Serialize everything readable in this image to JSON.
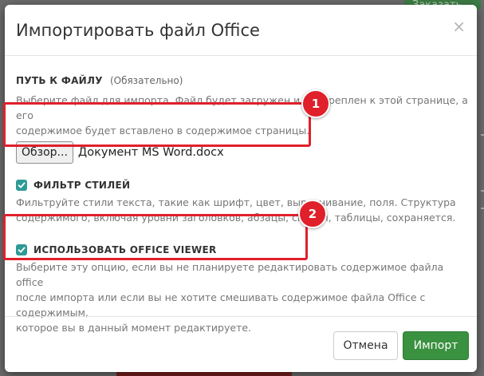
{
  "background": {
    "order_button_label": "Заказать"
  },
  "dialog": {
    "title": "Импортировать файл Office",
    "close_symbol": "×",
    "file_field": {
      "label": "ПУТЬ К ФАЙЛУ",
      "required_note": "(Обязательно)",
      "help_line1": "Выберите файл для импорта. Файл будет загружен и прикреплен к этой странице, а его",
      "help_line2": "содержимое будет вставлено в содержимое страницы.",
      "browse_label": "Обзор...",
      "file_name": "Документ MS Word.docx"
    },
    "style_filter": {
      "label": "ФИЛЬТР СТИЛЕЙ",
      "checked": true,
      "help_line1": "Фильтруйте стили текста, такие как шрифт, цвет, выравнивание, поля. Структура",
      "help_line2": "содержимого, включая уровни заголовков, абзацы, списки, таблицы, сохраняется."
    },
    "office_viewer": {
      "label": "ИСПОЛЬЗОВАТЬ OFFICE VIEWER",
      "checked": true,
      "help_line1": "Выберите эту опцию, если вы не планируете редактировать содержимое файла office",
      "help_line2": "после импорта или если вы не хотите смешивать содержимое файла Office с содержимым,",
      "help_line3": "которое вы в данный момент редактируете."
    },
    "cancel_label": "Отмена",
    "import_label": "Импорт"
  },
  "annotations": {
    "badge1": "1",
    "badge2": "2"
  },
  "colors": {
    "accent_green": "#3a9140",
    "checkbox_teal": "#2f9a96",
    "highlight_red": "#e0202a"
  }
}
